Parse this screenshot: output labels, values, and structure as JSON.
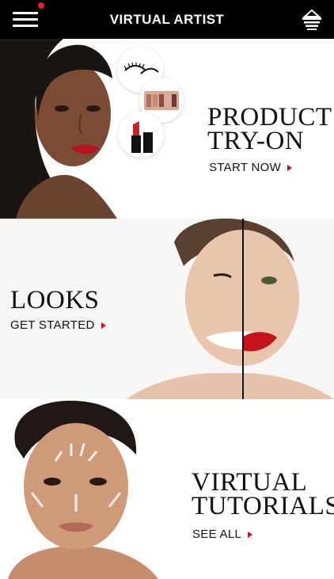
{
  "header": {
    "title": "VIRTUAL ARTIST",
    "menu_icon": "hamburger-menu-icon",
    "basket_icon": "basket-icon",
    "notification_color": "#e0202a"
  },
  "panels": [
    {
      "title_line1": "PRODUCT",
      "title_line2": "TRY-ON",
      "cta": "START NOW"
    },
    {
      "title_line1": "LOOKS",
      "cta": "GET STARTED"
    },
    {
      "title_line1": "VIRTUAL",
      "title_line2": "TUTORIALS",
      "cta": "SEE ALL"
    }
  ],
  "colors": {
    "header_bg": "#000000",
    "accent": "#d0101a"
  }
}
